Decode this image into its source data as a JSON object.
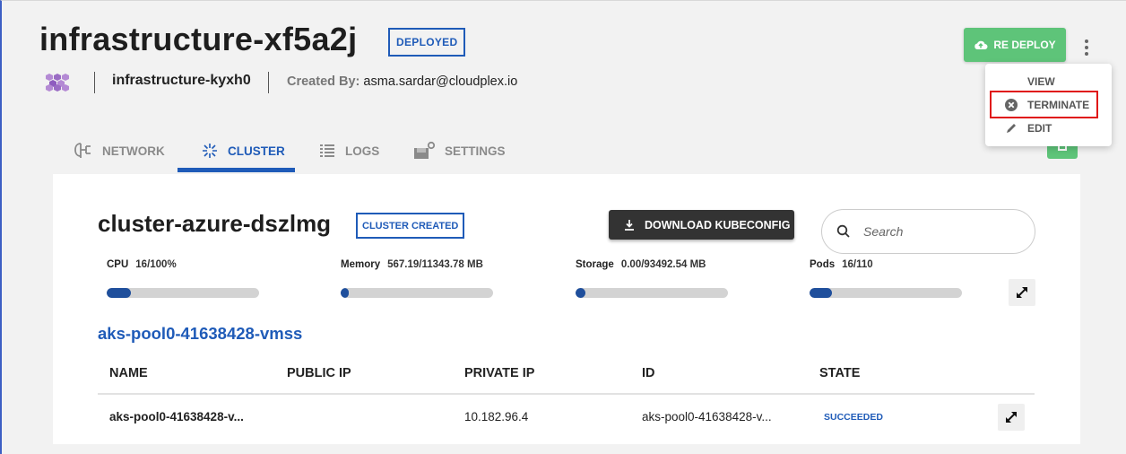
{
  "header": {
    "title": "infrastructure-xf5a2j",
    "status": "DEPLOYED",
    "sub_name": "infrastructure-kyxh0",
    "created_by_label": "Created By:",
    "created_by_value": "asma.sardar@cloudplex.io",
    "redeploy_label": "RE DEPLOY"
  },
  "menu": {
    "items": [
      {
        "label": "VIEW",
        "icon": "none"
      },
      {
        "label": "TERMINATE",
        "icon": "x-circle-icon"
      },
      {
        "label": "EDIT",
        "icon": "pencil-icon"
      }
    ]
  },
  "tabs": [
    {
      "label": "NETWORK",
      "icon": "network-icon",
      "active": false
    },
    {
      "label": "CLUSTER",
      "icon": "cluster-icon",
      "active": true
    },
    {
      "label": "LOGS",
      "icon": "logs-icon",
      "active": false
    },
    {
      "label": "SETTINGS",
      "icon": "settings-icon",
      "active": false
    }
  ],
  "cluster": {
    "name": "cluster-azure-dszlmg",
    "status": "CLUSTER CREATED",
    "download_label": "DOWNLOAD KUBECONFIG",
    "search_placeholder": "Search",
    "metrics": [
      {
        "label": "CPU",
        "value": "16/100%",
        "fraction": 0.16
      },
      {
        "label": "Memory",
        "value": "567.19/11343.78 MB",
        "fraction": 0.05
      },
      {
        "label": "Storage",
        "value": "0.00/93492.54 MB",
        "fraction": 0.0
      },
      {
        "label": "Pods",
        "value": "16/110",
        "fraction": 0.145
      }
    ]
  },
  "pool": {
    "name": "aks-pool0-41638428-vmss",
    "columns": [
      "NAME",
      "PUBLIC IP",
      "PRIVATE IP",
      "ID",
      "STATE"
    ],
    "rows": [
      {
        "name": "aks-pool0-41638428-v...",
        "public_ip": "",
        "private_ip": "10.182.96.4",
        "id": "aks-pool0-41638428-v...",
        "state": "SUCCEEDED"
      }
    ]
  },
  "colors": {
    "accent_blue": "#1f5bb8",
    "success_green": "#5ec479",
    "danger_red": "#e01616",
    "bar_fill": "#1f4f9c"
  }
}
